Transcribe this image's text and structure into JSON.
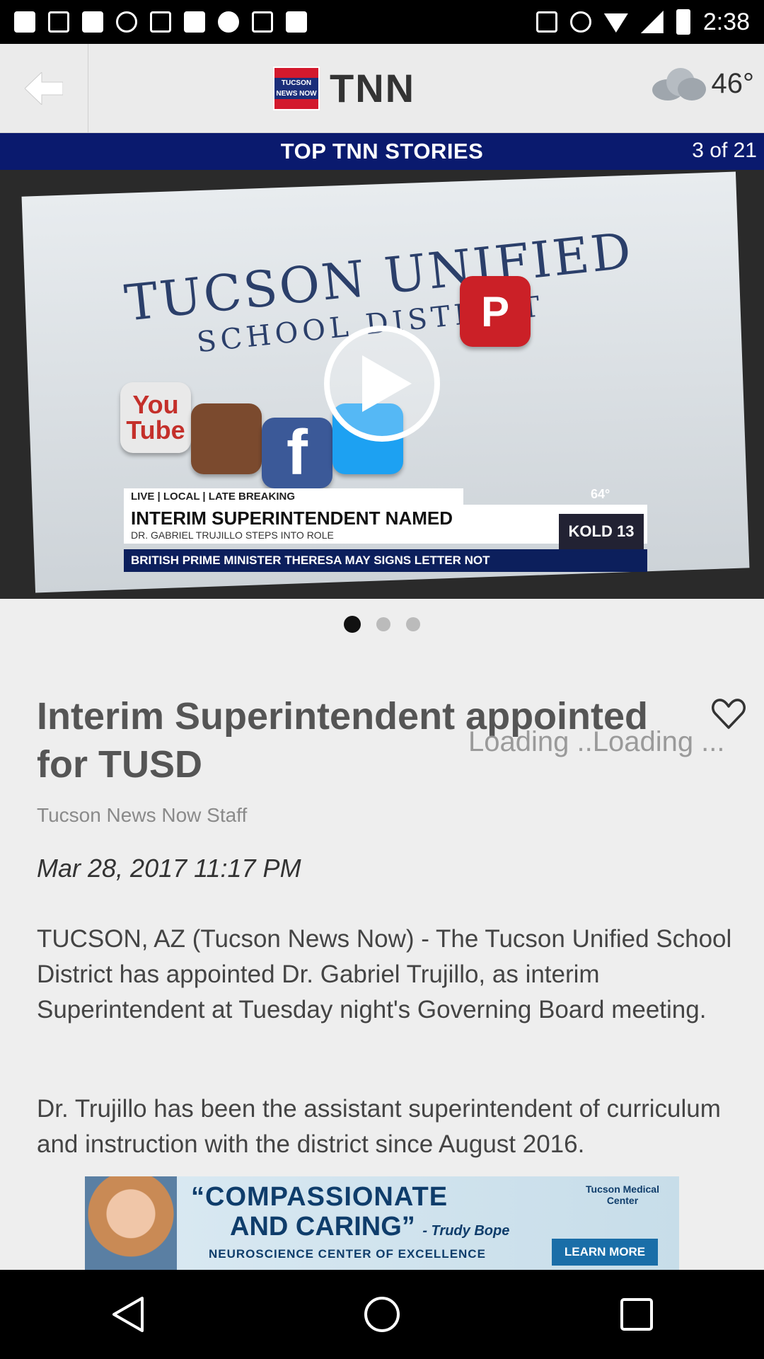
{
  "status_bar": {
    "time": "2:38"
  },
  "header": {
    "logo_badge": "TUCSON NEWS NOW",
    "logo_text": "TNN",
    "weather_temp": "46°"
  },
  "section": {
    "title": "TOP TNN STORIES",
    "count": "3 of 21"
  },
  "video": {
    "board_line1": "TUCSON UNIFIED",
    "board_line2": "SCHOOL DISTRICT",
    "tile_youtube": "You Tube",
    "tile_facebook": "f",
    "tile_pinterest": "P",
    "lower_third_tag": "LIVE | LOCAL | LATE BREAKING",
    "lower_third_headline": "INTERIM SUPERINTENDENT NAMED",
    "lower_third_sub": "DR. GABRIEL TRUJILLO STEPS INTO ROLE",
    "ticker": "BRITISH PRIME MINISTER THERESA MAY SIGNS LETTER NOT",
    "station": "KOLD 13",
    "station_temp": "64°"
  },
  "carousel": {
    "active_index": 0,
    "total": 3
  },
  "article": {
    "headline": "Interim Superintendent appointed for TUSD",
    "loading_text": "Loading ..Loading ...",
    "byline": "Tucson News Now Staff",
    "date": "Mar 28, 2017 11:17 PM",
    "paragraph1": "TUCSON, AZ (Tucson News Now) - The Tucson Unified School District has appointed Dr. Gabriel Trujillo, as interim Superintendent at Tuesday night's Governing Board meeting.",
    "paragraph2": "Dr. Trujillo has been the assistant superintendent of curriculum and instruction with the district since August 2016."
  },
  "ad": {
    "line1": "“COMPASSIONATE",
    "line2": "AND CARING”",
    "line2_author": "- Trudy Bope",
    "line3": "NEUROSCIENCE CENTER OF EXCELLENCE",
    "cta": "LEARN MORE",
    "brand": "Tucson Medical Center"
  },
  "colors": {
    "section_bar": "#0a1a6e",
    "header_bg": "#ebebeb",
    "accent_red": "#d3192d"
  },
  "icons": {
    "back": "back-arrow-icon",
    "weather": "cloud-icon",
    "play": "play-icon",
    "favorite": "heart-icon",
    "nav_back": "triangle-back-icon",
    "nav_home": "circle-home-icon",
    "nav_recent": "square-recent-icon"
  }
}
